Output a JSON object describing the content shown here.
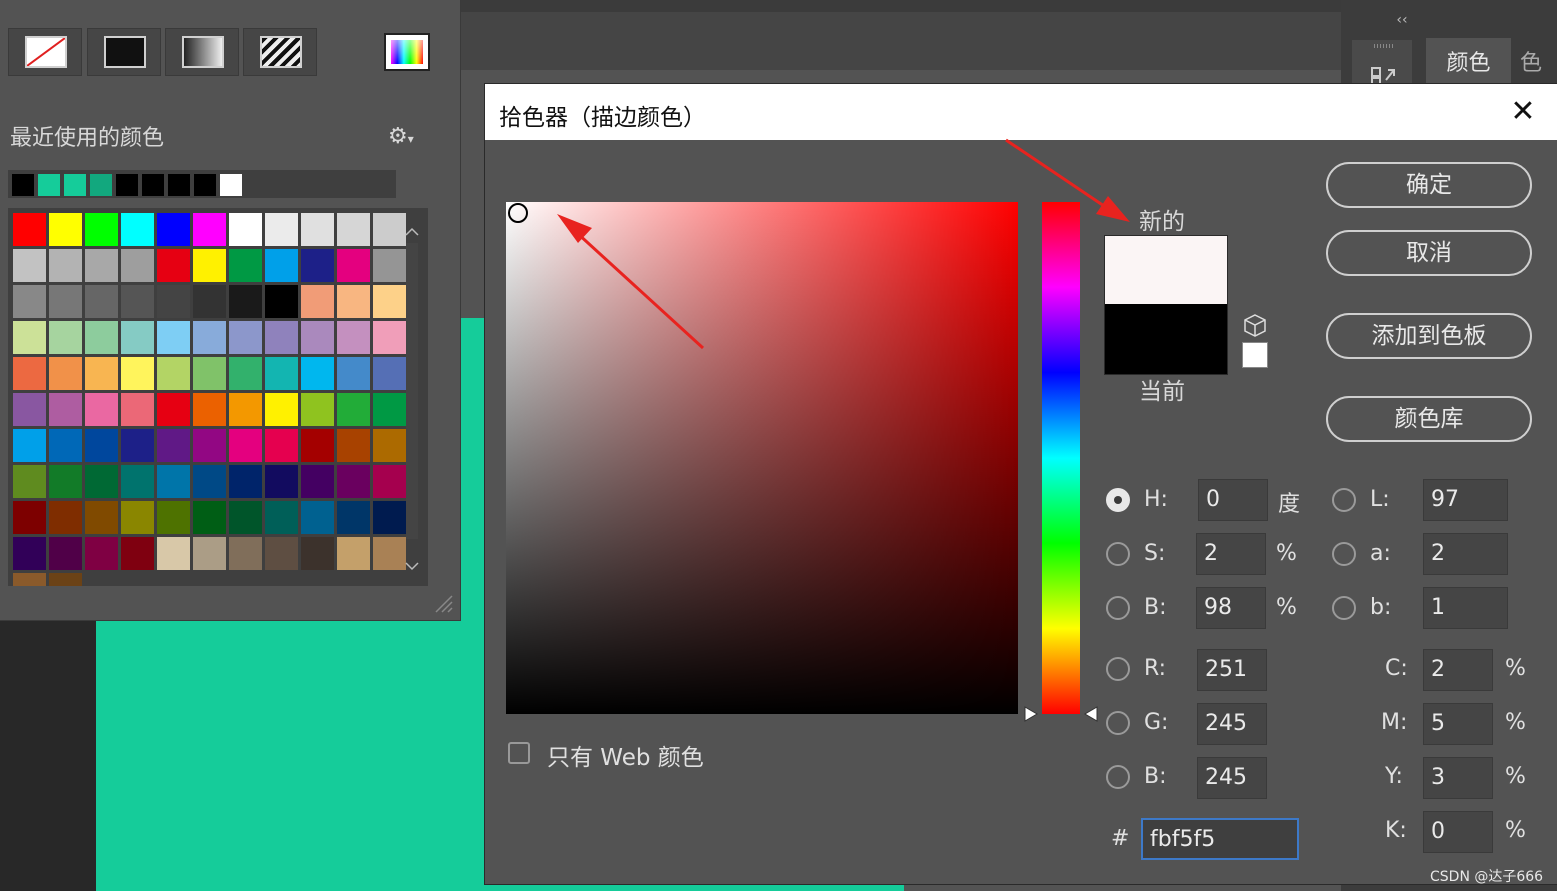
{
  "swatches_panel": {
    "recent_title": "最近使用的颜色",
    "recent_colors": [
      "#000000",
      "#15cc9a",
      "#15cc9a",
      "#12a87e",
      "#000000",
      "#000000",
      "#000000",
      "#000000",
      "#ffffff"
    ],
    "grid_colors": [
      [
        "#ff0000",
        "#ffff00",
        "#00ff00",
        "#00ffff",
        "#0000ff",
        "#ff00ff",
        "#ffffff",
        "#ebebeb",
        "#e0e0e0",
        "#d6d6d6",
        "#cccccc"
      ],
      [
        "#c2c2c2",
        "#b3b3b3",
        "#a8a8a8",
        "#9e9e9e",
        "#e60012",
        "#fff100",
        "#009944",
        "#00a0e9",
        "#1d2088",
        "#e4007f",
        "#959595"
      ],
      [
        "#888888",
        "#777777",
        "#666666",
        "#555555",
        "#444444",
        "#333333",
        "#1a1a1a",
        "#000000",
        "#f19c77",
        "#f8b681",
        "#fdd189"
      ],
      [
        "#cce198",
        "#a6d49f",
        "#8dcc9d",
        "#85cbc4",
        "#7ecef4",
        "#88abda",
        "#8c97cb",
        "#8f82bc",
        "#aa89bd",
        "#c490bf",
        "#f09eb9"
      ],
      [
        "#ec6941",
        "#f19149",
        "#f8b551",
        "#fff45c",
        "#b3d465",
        "#80c269",
        "#32b16c",
        "#13b5b1",
        "#00b7ee",
        "#448aca",
        "#556fb5"
      ],
      [
        "#8957a1",
        "#ae5da1",
        "#ea68a2",
        "#eb6877",
        "#e60012",
        "#eb6100",
        "#f39800",
        "#fff100",
        "#8fc31f",
        "#22ac38",
        "#009944"
      ],
      [
        "#00a0e9",
        "#0068b7",
        "#00479d",
        "#1d2088",
        "#601986",
        "#920783",
        "#e4007f",
        "#e5004f",
        "#a40000",
        "#a84200",
        "#ac6a00"
      ],
      [
        "#5f8b1f",
        "#127b28",
        "#006934",
        "#00736d",
        "#0075a9",
        "#004986",
        "#00246a",
        "#120b5f",
        "#440062",
        "#6a005f",
        "#a5004e"
      ],
      [
        "#7d0000",
        "#7f2d00",
        "#804a00",
        "#8a8600",
        "#4e7200",
        "#005e15",
        "#00552a",
        "#005f58",
        "#006190",
        "#003668",
        "#001b4f"
      ],
      [
        "#310058",
        "#500048",
        "#7f0043",
        "#7f0010",
        "#d8c8a8",
        "#ab9d86",
        "#806e5a",
        "#5e4e42",
        "#3c322c",
        "#c4a06a",
        "#a98155"
      ],
      [
        "#8a5a2b",
        "#6b4216"
      ]
    ]
  },
  "workspace": {
    "right_tab_active": "颜色",
    "right_tab_partial": "色",
    "collapse_glyph": "‹‹",
    "canvas_color": "#15cc9a"
  },
  "dialog": {
    "title": "拾色器（描边颜色）",
    "close_glyph": "✕",
    "label_new": "新的",
    "label_current": "当前",
    "new_color": "#fbf5f5",
    "current_color": "#000000",
    "web_only_label": "只有 Web 颜色",
    "buttons": {
      "ok": "确定",
      "cancel": "取消",
      "add_to_swatches": "添加到色板",
      "color_libraries": "颜色库"
    },
    "hsb": {
      "h": {
        "label": "H:",
        "value": "0",
        "unit": "度",
        "selected": true
      },
      "s": {
        "label": "S:",
        "value": "2",
        "unit": "%"
      },
      "b": {
        "label": "B:",
        "value": "98",
        "unit": "%"
      }
    },
    "lab": {
      "l": {
        "label": "L:",
        "value": "97"
      },
      "a": {
        "label": "a:",
        "value": "2"
      },
      "b": {
        "label": "b:",
        "value": "1"
      }
    },
    "rgb": {
      "r": {
        "label": "R:",
        "value": "251"
      },
      "g": {
        "label": "G:",
        "value": "245"
      },
      "b": {
        "label": "B:",
        "value": "245"
      }
    },
    "cmyk": {
      "c": {
        "label": "C:",
        "value": "2",
        "unit": "%"
      },
      "m": {
        "label": "M:",
        "value": "5",
        "unit": "%"
      },
      "y": {
        "label": "Y:",
        "value": "3",
        "unit": "%"
      },
      "k": {
        "label": "K:",
        "value": "0",
        "unit": "%"
      }
    },
    "hex": {
      "label": "#",
      "value": "fbf5f5"
    }
  },
  "annotations": {
    "arrow_color": "#e8231f"
  },
  "watermark": "CSDN @达子666"
}
